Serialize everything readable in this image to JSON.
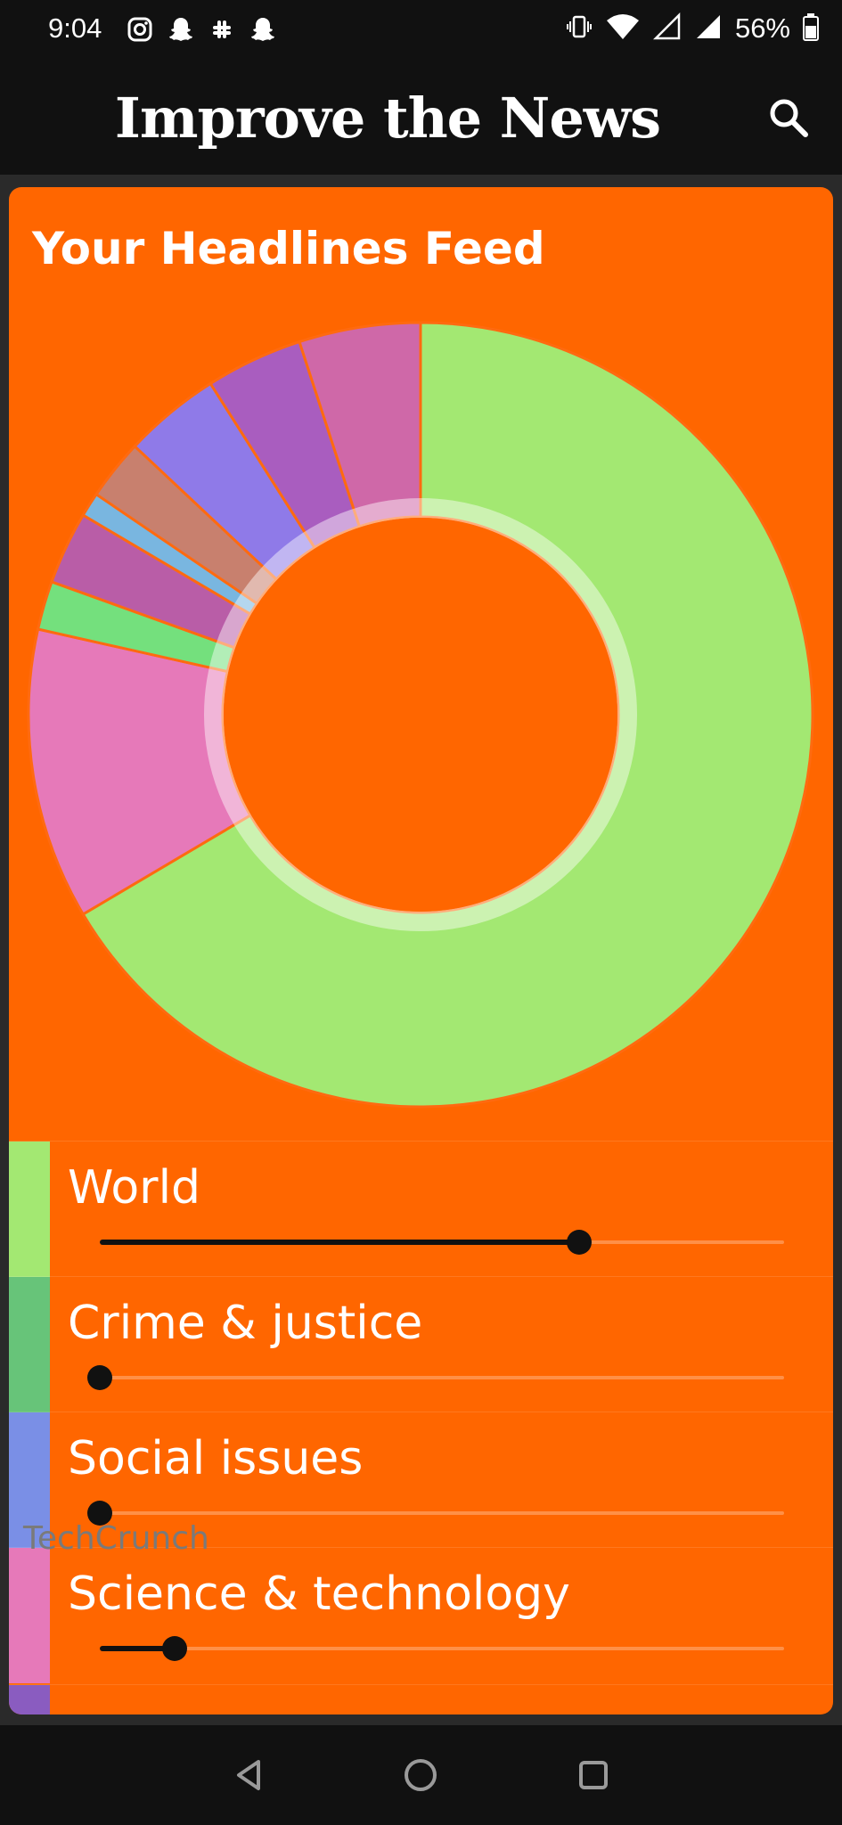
{
  "status_bar": {
    "time": "9:04",
    "battery": "56%",
    "left_icons": [
      "instagram-icon",
      "snapchat-icon",
      "slack-icon",
      "snapchat-icon"
    ],
    "right_icons": [
      "vibrate-icon",
      "wifi-icon",
      "signal-empty-icon",
      "signal-icon",
      "battery-icon"
    ]
  },
  "header": {
    "title": "Improve the News",
    "search_icon": "search-icon"
  },
  "card": {
    "title": "Your Headlines Feed",
    "background": "#ff6600"
  },
  "chart_data": {
    "type": "pie",
    "style": "donut",
    "slices": [
      {
        "color": "#a3e872",
        "value": 66.5
      },
      {
        "color": "#e679b9",
        "value": 12.0
      },
      {
        "color": "#74e07d",
        "value": 2.0
      },
      {
        "color": "#b95da7",
        "value": 3.0
      },
      {
        "color": "#79b6e0",
        "value": 1.0
      },
      {
        "color": "#c8806e",
        "value": 2.5
      },
      {
        "color": "#8f7ae8",
        "value": 4.0
      },
      {
        "color": "#a95dbf",
        "value": 4.0
      },
      {
        "color": "#cf68a8",
        "value": 5.0
      }
    ]
  },
  "topics": [
    {
      "label": "World",
      "color": "#a3e872",
      "slider_value": 0.7
    },
    {
      "label": "Crime & justice",
      "color": "#67c479",
      "slider_value": 0.0
    },
    {
      "label": "Social issues",
      "color": "#7a8fe6",
      "slider_value": 0.0
    },
    {
      "label": "Science & technology",
      "color": "#e679b9",
      "slider_value": 0.11
    }
  ],
  "partial_row": {
    "color": "#8a5cc0",
    "label": "TechCrunch"
  },
  "nav_bar": {
    "back_icon": "back-triangle-icon",
    "home_icon": "home-circle-icon",
    "recents_icon": "recents-square-icon"
  }
}
